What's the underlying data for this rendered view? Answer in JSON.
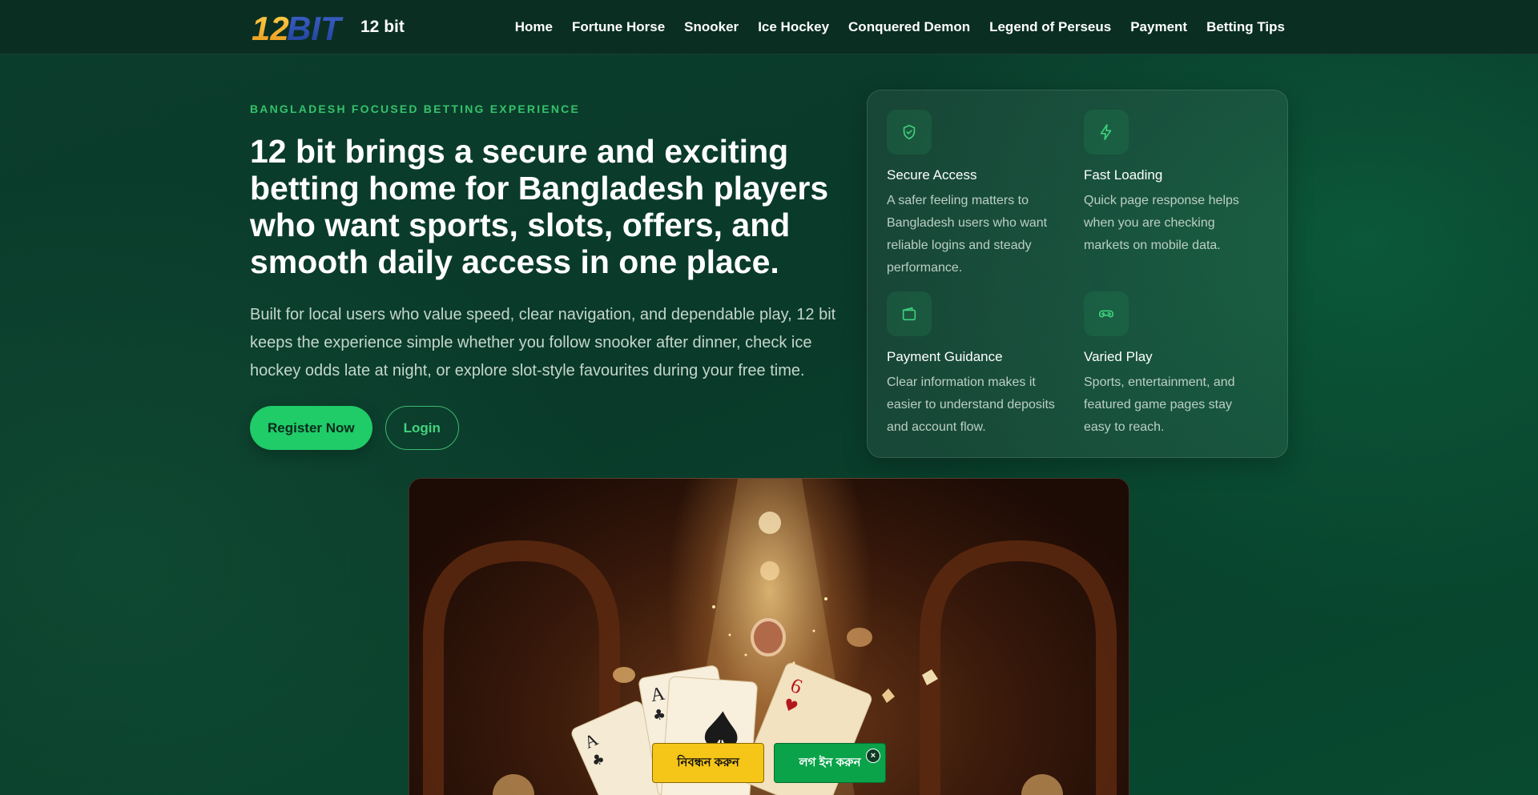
{
  "header": {
    "brand": {
      "logo_text": "12BIT",
      "name": "12 bit"
    },
    "nav": [
      {
        "label": "Home"
      },
      {
        "label": "Fortune Horse"
      },
      {
        "label": "Snooker"
      },
      {
        "label": "Ice Hockey"
      },
      {
        "label": "Conquered Demon"
      },
      {
        "label": "Legend of Perseus"
      },
      {
        "label": "Payment"
      },
      {
        "label": "Betting Tips"
      }
    ]
  },
  "hero": {
    "eyebrow": "BANGLADESH FOCUSED BETTING EXPERIENCE",
    "title": "12 bit brings a secure and exciting betting home for Bangladesh players who want sports, slots, offers, and smooth daily access in one place.",
    "description": "Built for local users who value speed, clear navigation, and dependable play, 12 bit keeps the experience simple whether you follow snooker after dinner, check ice hockey odds late at night, or explore slot-style favourites during your free time.",
    "register_label": "Register Now",
    "login_label": "Login"
  },
  "features": [
    {
      "icon": "shield-check-icon",
      "title": "Secure Access",
      "text": "A safer feeling matters to Bangladesh users who want reliable logins and steady performance."
    },
    {
      "icon": "lightning-icon",
      "title": "Fast Loading",
      "text": "Quick page response helps when you are checking markets on mobile data."
    },
    {
      "icon": "wallet-icon",
      "title": "Payment Guidance",
      "text": "Clear information makes it easier to understand deposits and account flow."
    },
    {
      "icon": "gamepad-icon",
      "title": "Varied Play",
      "text": "Sports, entertainment, and featured game pages stay easy to reach."
    }
  ],
  "floating_bar": {
    "register_label": "নিবন্ধন করুন",
    "login_label": "লগ ইন করুন",
    "close_label": "×"
  },
  "colors": {
    "accent": "#1fcc68",
    "eyebrow": "#35c26b",
    "header_bg": "#0a2e22",
    "float_register_bg": "#f5c518",
    "float_login_bg": "#0aa34a"
  }
}
